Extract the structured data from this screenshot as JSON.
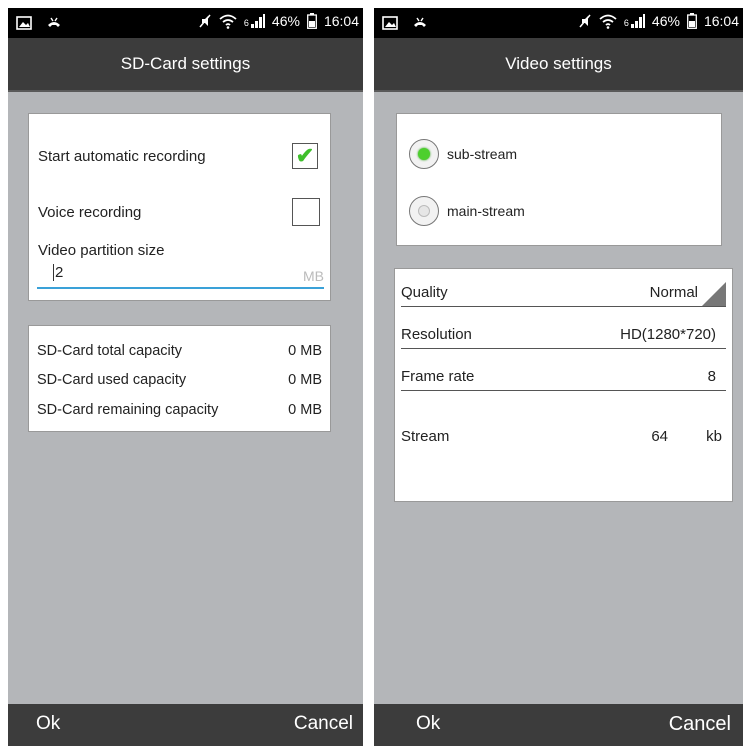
{
  "status_bar": {
    "battery_percent": "46%",
    "time": "16:04",
    "network_label": "6",
    "icons": [
      "image-icon",
      "call-icon",
      "mute-icon",
      "wifi-icon",
      "signal-icon",
      "battery-icon"
    ]
  },
  "sd_card_screen": {
    "title": "SD-Card settings",
    "start_auto_recording": {
      "label": "Start automatic recording",
      "checked": true
    },
    "voice_recording": {
      "label": "Voice recording",
      "checked": false
    },
    "video_partition": {
      "label": "Video partition size",
      "value": "2",
      "unit": "MB"
    },
    "capacity": [
      {
        "label": "SD-Card total capacity",
        "value": "0 MB"
      },
      {
        "label": "SD-Card used capacity",
        "value": "0 MB"
      },
      {
        "label": "SD-Card remaining capacity",
        "value": "0 MB"
      }
    ],
    "ok_label": "Ok",
    "cancel_label": "Cancel"
  },
  "video_screen": {
    "title": "Video settings",
    "streams": [
      {
        "label": "sub-stream",
        "selected": true
      },
      {
        "label": "main-stream",
        "selected": false
      }
    ],
    "quality": {
      "label": "Quality",
      "value": "Normal"
    },
    "resolution": {
      "label": "Resolution",
      "value": "HD(1280*720)"
    },
    "frame_rate": {
      "label": "Frame rate",
      "value": "8"
    },
    "stream": {
      "label": "Stream",
      "value": "64",
      "unit": "kb"
    },
    "ok_label": "Ok",
    "cancel_label": "Cancel"
  },
  "colors": {
    "background": "#b4b6b9",
    "bar": "#3c3c3c",
    "accent_blue": "#3aa1d8",
    "check_green": "#3fbf2c"
  }
}
